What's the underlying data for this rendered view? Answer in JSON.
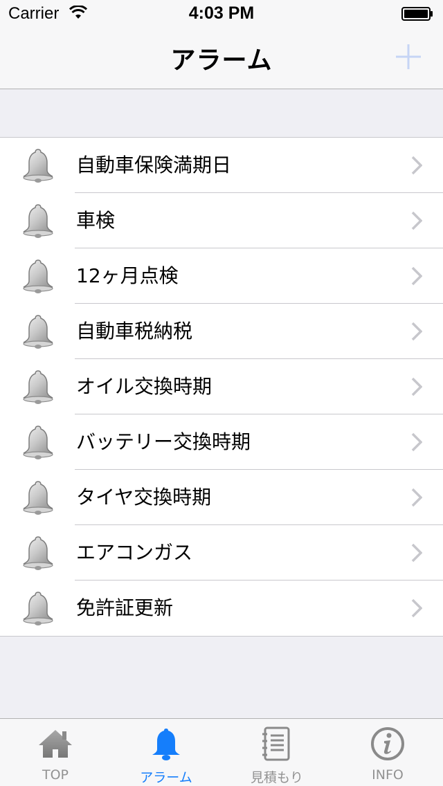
{
  "status_bar": {
    "carrier": "Carrier",
    "time": "4:03 PM"
  },
  "nav": {
    "title": "アラーム",
    "add_icon": "plus-icon"
  },
  "alarms": [
    {
      "label": "自動車保険満期日"
    },
    {
      "label": "車検"
    },
    {
      "label": "12ヶ月点検"
    },
    {
      "label": "自動車税納税"
    },
    {
      "label": "オイル交換時期"
    },
    {
      "label": "バッテリー交換時期"
    },
    {
      "label": "タイヤ交換時期"
    },
    {
      "label": "エアコンガス"
    },
    {
      "label": "免許証更新"
    }
  ],
  "tabs": [
    {
      "label": "TOP",
      "icon": "home-icon",
      "active": false
    },
    {
      "label": "アラーム",
      "icon": "bell-icon",
      "active": true
    },
    {
      "label": "見積もり",
      "icon": "notebook-icon",
      "active": false
    },
    {
      "label": "INFO",
      "icon": "info-icon",
      "active": false
    }
  ],
  "colors": {
    "accent": "#157efb",
    "inactive_tab": "#929292",
    "add_button": "#c6d4f5"
  }
}
